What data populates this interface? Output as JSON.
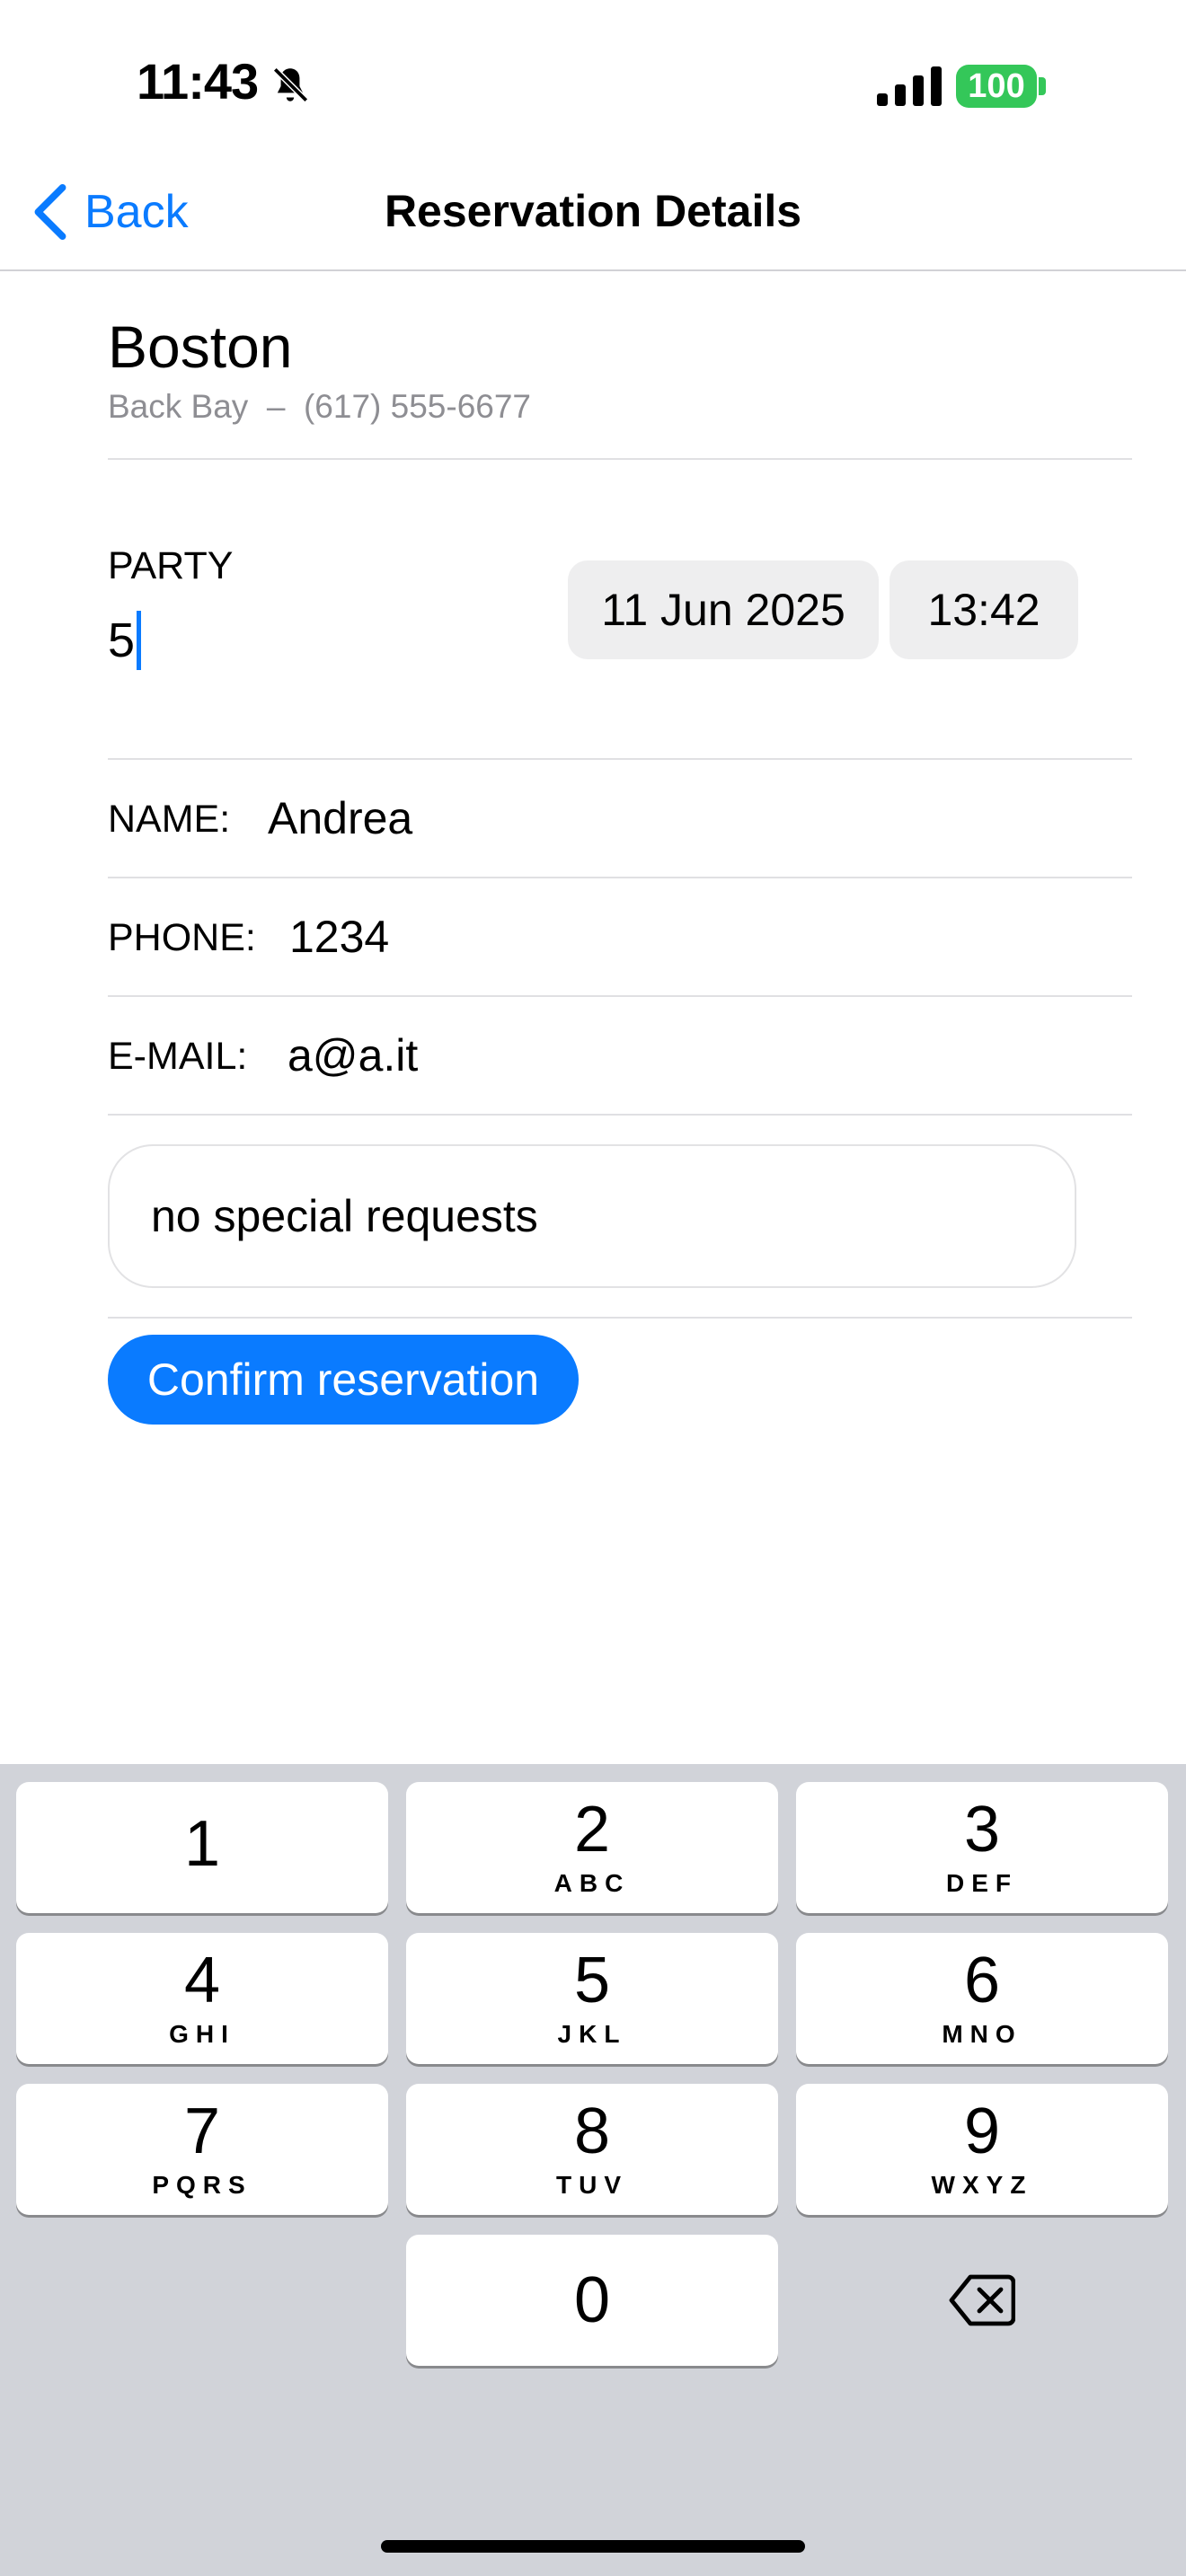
{
  "status_bar": {
    "time": "11:43",
    "battery": "100"
  },
  "nav": {
    "back_label": "Back",
    "title": "Reservation Details"
  },
  "restaurant": {
    "name": "Boston",
    "subtitle": "Back Bay  –  (617) 555-6677"
  },
  "party": {
    "label": "PARTY",
    "value": "5"
  },
  "date": "11 Jun 2025",
  "time": "13:42",
  "fields": {
    "name_label": "NAME:",
    "name_value": "Andrea",
    "phone_label": "PHONE:",
    "phone_value": "1234",
    "email_label": "E-MAIL:",
    "email_value": "a@a.it"
  },
  "special_requests": "no special requests",
  "confirm_label": "Confirm reservation",
  "keyboard": {
    "keys": [
      {
        "num": "1",
        "letters": ""
      },
      {
        "num": "2",
        "letters": "ABC"
      },
      {
        "num": "3",
        "letters": "DEF"
      },
      {
        "num": "4",
        "letters": "GHI"
      },
      {
        "num": "5",
        "letters": "JKL"
      },
      {
        "num": "6",
        "letters": "MNO"
      },
      {
        "num": "7",
        "letters": "PQRS"
      },
      {
        "num": "8",
        "letters": "TUV"
      },
      {
        "num": "9",
        "letters": "WXYZ"
      },
      {
        "num": "0",
        "letters": ""
      }
    ]
  },
  "colors": {
    "accent": "#0a7bff",
    "battery": "#34c759",
    "keyboard_bg": "#d1d3d9"
  }
}
